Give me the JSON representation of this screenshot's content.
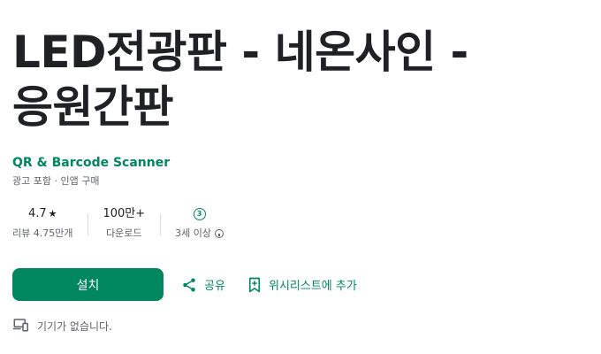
{
  "app": {
    "title_line1": "LED전광판 - 네온사인 -",
    "title_line2": "응원간판",
    "developer": "QR & Barcode Scanner",
    "meta": "광고 포함 · 인앱 구매"
  },
  "stats": {
    "rating_value": "4.7",
    "rating_star": "★",
    "rating_label": "리뷰 4.75만개",
    "downloads_value": "100만+",
    "downloads_label": "다운로드",
    "age_badge": "3",
    "age_label": "3세 이상"
  },
  "actions": {
    "install_label": "설치",
    "share_label": "공유",
    "wishlist_label": "위시리스트에 추가"
  },
  "devices": {
    "message": "기기가 없습니다."
  },
  "colors": {
    "accent": "#01875f",
    "text": "#202124",
    "secondary_text": "#5f6368"
  }
}
